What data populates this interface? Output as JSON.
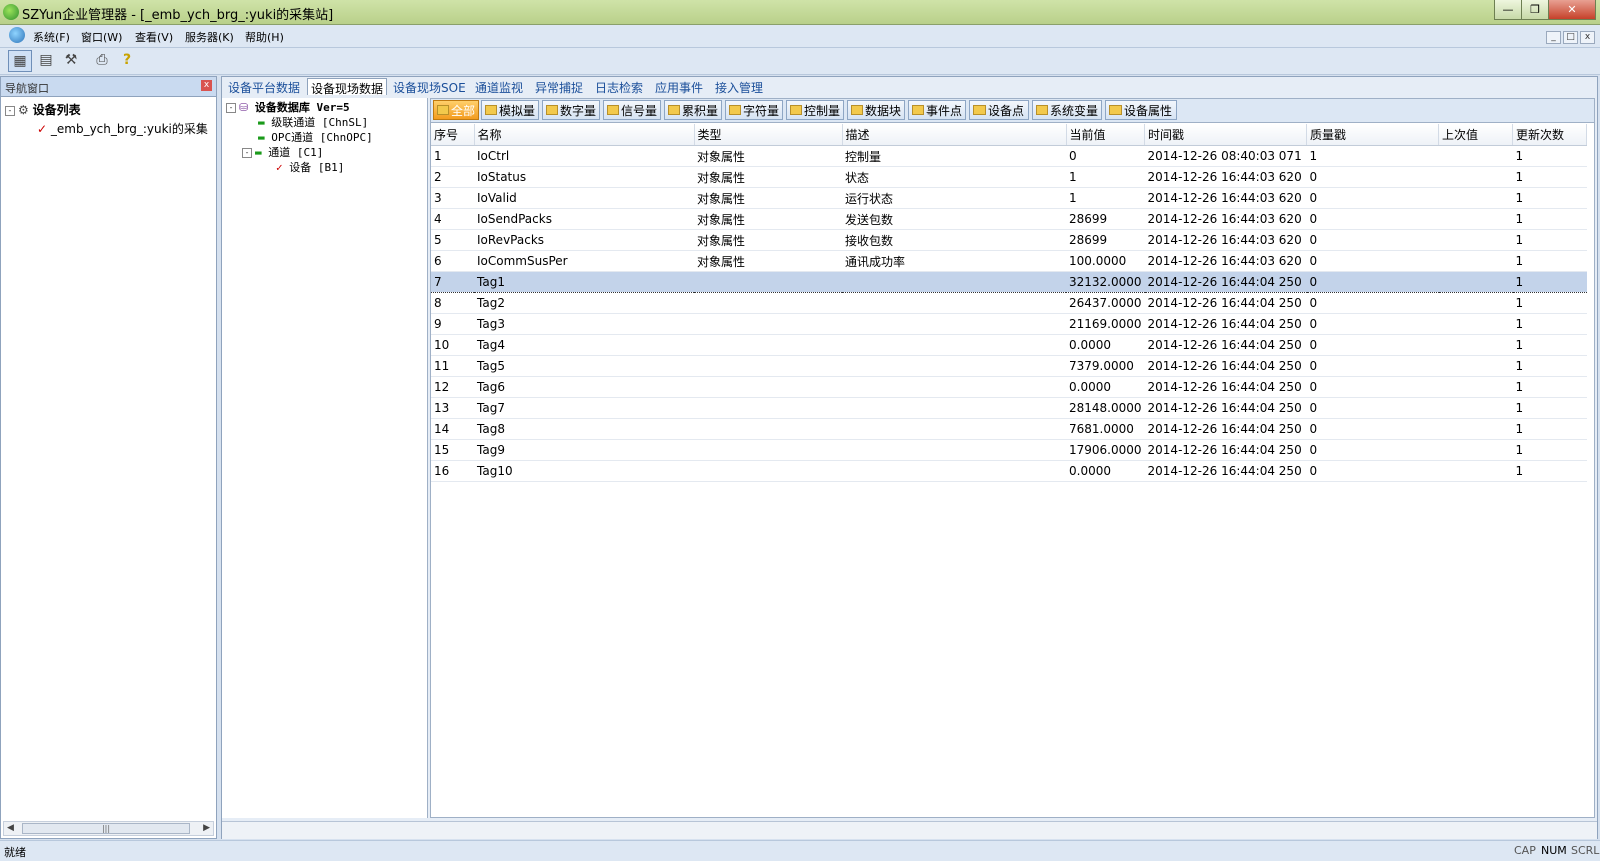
{
  "window": {
    "title": "SZYun企业管理器 - [_emb_ych_brg_:yuki的采集站]"
  },
  "menu": [
    "系统(F)",
    "窗口(W)",
    "查看(V)",
    "服务器(K)",
    "帮助(H)"
  ],
  "nav": {
    "title": "导航窗口",
    "root_label": "设备列表",
    "child_label": "_emb_ych_brg_:yuki的采集"
  },
  "main_tabs": [
    "设备平台数据",
    "设备现场数据",
    "设备现场SOE",
    "通道监视",
    "异常捕捉",
    "日志检索",
    "应用事件",
    "接入管理"
  ],
  "main_tabs_active": 1,
  "db_tree": {
    "root": "设备数据库 Ver=5",
    "items": [
      "级联通道 [ChnSL]",
      "OPC通道 [ChnOPC]",
      "通道 [C1]",
      "设备 [B1]"
    ]
  },
  "filter_tabs": [
    "全部",
    "模拟量",
    "数字量",
    "信号量",
    "累积量",
    "字符量",
    "控制量",
    "数据块",
    "事件点",
    "设备点",
    "系统变量",
    "设备属性"
  ],
  "grid": {
    "columns": [
      "序号",
      "名称",
      "类型",
      "描述",
      "当前值",
      "时间戳",
      "质量戳",
      "上次值",
      "更新次数"
    ],
    "rows": [
      [
        "1",
        "IoCtrl",
        "对象属性",
        "控制量",
        "0",
        "2014-12-26 08:40:03 071",
        "1",
        "",
        "1"
      ],
      [
        "2",
        "IoStatus",
        "对象属性",
        "状态",
        "1",
        "2014-12-26 16:44:03 620",
        "0",
        "",
        "1"
      ],
      [
        "3",
        "IoValid",
        "对象属性",
        "运行状态",
        "1",
        "2014-12-26 16:44:03 620",
        "0",
        "",
        "1"
      ],
      [
        "4",
        "IoSendPacks",
        "对象属性",
        "发送包数",
        "28699",
        "2014-12-26 16:44:03 620",
        "0",
        "",
        "1"
      ],
      [
        "5",
        "IoRevPacks",
        "对象属性",
        "接收包数",
        "28699",
        "2014-12-26 16:44:03 620",
        "0",
        "",
        "1"
      ],
      [
        "6",
        "IoCommSusPer",
        "对象属性",
        "通讯成功率",
        "100.0000",
        "2014-12-26 16:44:03 620",
        "0",
        "",
        "1"
      ],
      [
        "7",
        "Tag1",
        "",
        "",
        "32132.0000",
        "2014-12-26 16:44:04 250",
        "0",
        "",
        "1"
      ],
      [
        "8",
        "Tag2",
        "",
        "",
        "26437.0000",
        "2014-12-26 16:44:04 250",
        "0",
        "",
        "1"
      ],
      [
        "9",
        "Tag3",
        "",
        "",
        "21169.0000",
        "2014-12-26 16:44:04 250",
        "0",
        "",
        "1"
      ],
      [
        "10",
        "Tag4",
        "",
        "",
        "0.0000",
        "2014-12-26 16:44:04 250",
        "0",
        "",
        "1"
      ],
      [
        "11",
        "Tag5",
        "",
        "",
        "7379.0000",
        "2014-12-26 16:44:04 250",
        "0",
        "",
        "1"
      ],
      [
        "12",
        "Tag6",
        "",
        "",
        "0.0000",
        "2014-12-26 16:44:04 250",
        "0",
        "",
        "1"
      ],
      [
        "13",
        "Tag7",
        "",
        "",
        "28148.0000",
        "2014-12-26 16:44:04 250",
        "0",
        "",
        "1"
      ],
      [
        "14",
        "Tag8",
        "",
        "",
        "7681.0000",
        "2014-12-26 16:44:04 250",
        "0",
        "",
        "1"
      ],
      [
        "15",
        "Tag9",
        "",
        "",
        "17906.0000",
        "2014-12-26 16:44:04 250",
        "0",
        "",
        "1"
      ],
      [
        "16",
        "Tag10",
        "",
        "",
        "0.0000",
        "2014-12-26 16:44:04 250",
        "0",
        "",
        "1"
      ]
    ],
    "selected_row": 6
  },
  "status": {
    "text": "就绪",
    "indicators": [
      "CAP",
      "NUM",
      "SCRL"
    ],
    "active_indicator": "NUM"
  },
  "icons": {
    "app": "globe-icon",
    "toolbar": [
      "window-layout-icon",
      "panel-icon",
      "tools-icon",
      "print-icon",
      "help-icon"
    ],
    "tree": [
      "tree-root-icon",
      "check-icon",
      "database-icon",
      "channel-icon",
      "device-check-icon"
    ],
    "folder": "folder-icon"
  }
}
